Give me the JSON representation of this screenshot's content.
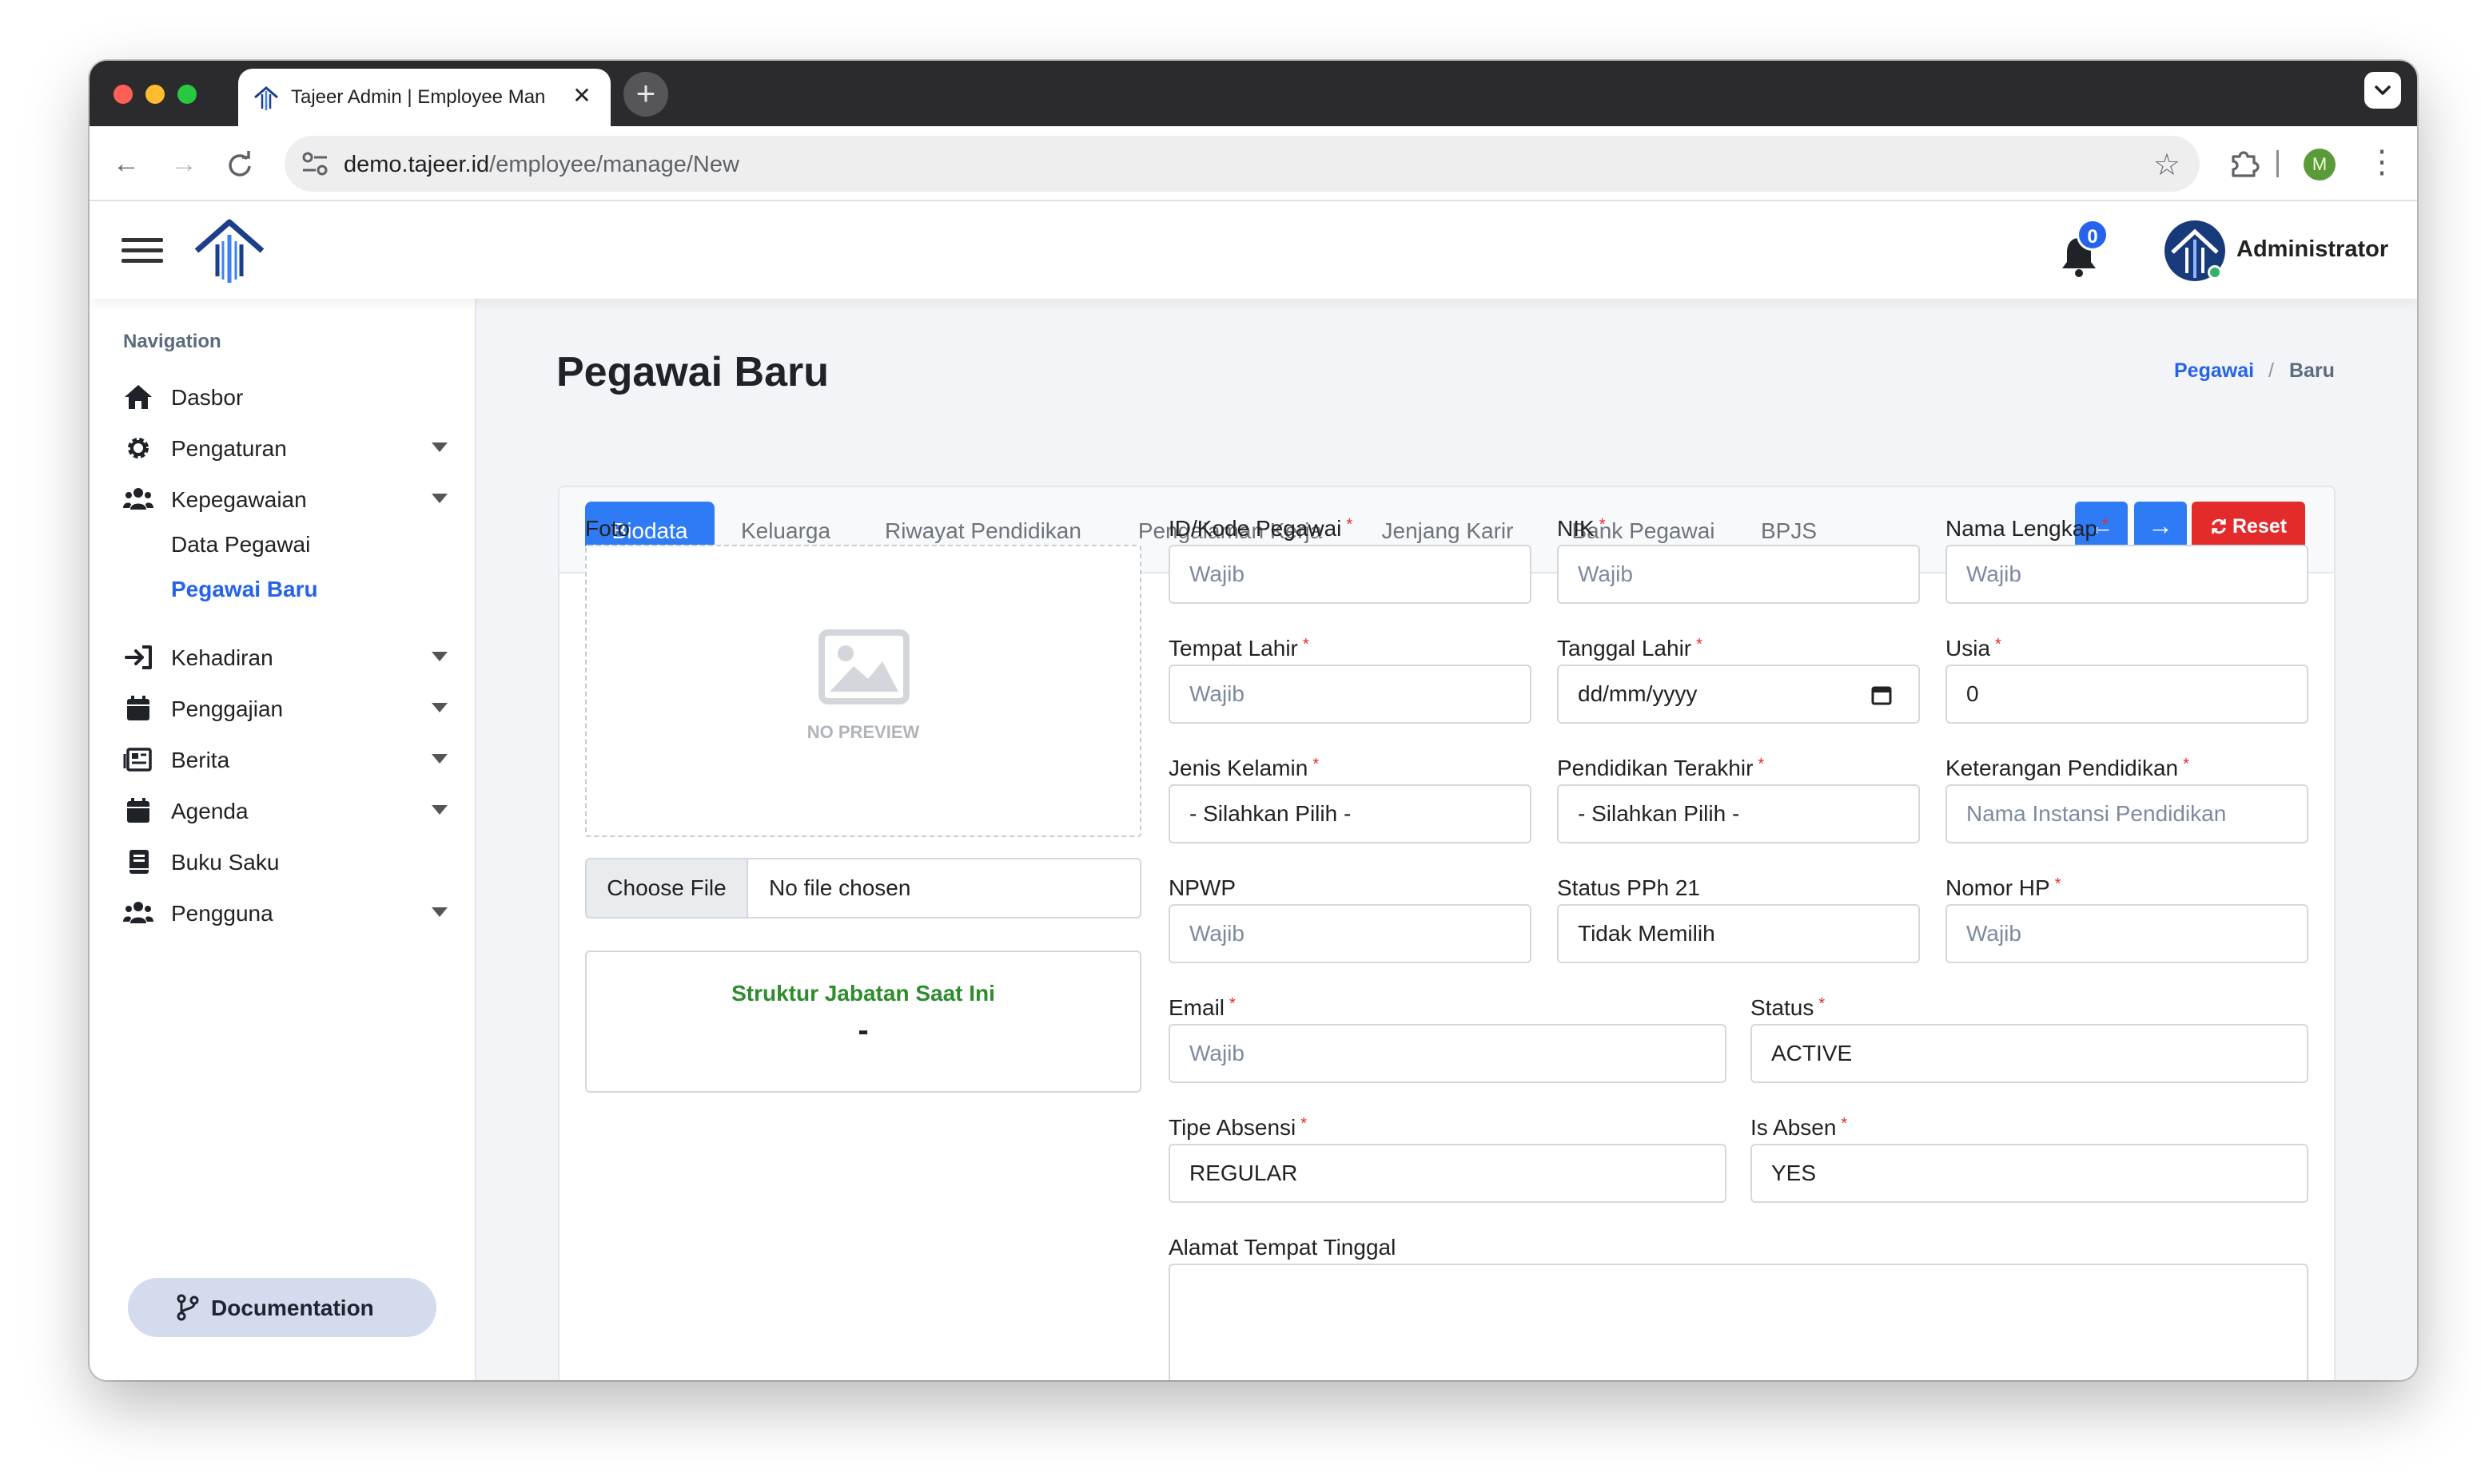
{
  "browser": {
    "tab_title": "Tajeer Admin | Employee Man",
    "url_host": "demo.tajeer.id",
    "url_path": "/employee/manage/New",
    "profile_initial": "M",
    "colors": {
      "close": "#ff5f57",
      "minimize": "#febc2e",
      "maximize": "#28c840"
    }
  },
  "header": {
    "notification_count": "0",
    "user_name": "Administrator"
  },
  "sidebar": {
    "heading": "Navigation",
    "items": [
      {
        "label": "Dasbor",
        "icon": "home-icon",
        "caret": false
      },
      {
        "label": "Pengaturan",
        "icon": "gear-icon",
        "caret": true
      },
      {
        "label": "Kepegawaian",
        "icon": "users-icon",
        "caret": true
      },
      {
        "label": "Kehadiran",
        "icon": "sign-in-icon",
        "caret": true
      },
      {
        "label": "Penggajian",
        "icon": "calendar-icon",
        "caret": true
      },
      {
        "label": "Berita",
        "icon": "newspaper-icon",
        "caret": true
      },
      {
        "label": "Agenda",
        "icon": "calendar-icon",
        "caret": true
      },
      {
        "label": "Buku Saku",
        "icon": "book-icon",
        "caret": false
      },
      {
        "label": "Pengguna",
        "icon": "users-icon",
        "caret": true
      }
    ],
    "subitems": [
      {
        "label": "Data Pegawai",
        "active": false
      },
      {
        "label": "Pegawai Baru",
        "active": true
      }
    ],
    "doc_label": "Documentation"
  },
  "page": {
    "title": "Pegawai Baru",
    "breadcrumb": {
      "first": "Pegawai",
      "sep": "/",
      "current": "Baru"
    }
  },
  "tabs": [
    "Biodata",
    "Keluarga",
    "Riwayat Pendidikan",
    "Pengalaman Kerja",
    "Jenjang Karir",
    "Bank Pegawai",
    "BPJS"
  ],
  "actions": {
    "prev": "←",
    "next": "→",
    "reset": "Reset"
  },
  "photo": {
    "label": "Foto",
    "no_preview": "NO PREVIEW",
    "choose_file": "Choose File",
    "no_file": "No file chosen",
    "struktur_title": "Struktur Jabatan Saat Ini",
    "struktur_value": "-"
  },
  "form": {
    "id_kode": {
      "label": "ID/Kode Pegawai",
      "placeholder": "Wajib"
    },
    "nik": {
      "label": "NIK",
      "placeholder": "Wajib"
    },
    "nama": {
      "label": "Nama Lengkap",
      "placeholder": "Wajib"
    },
    "tempat_lahir": {
      "label": "Tempat Lahir",
      "placeholder": "Wajib"
    },
    "tanggal_lahir": {
      "label": "Tanggal Lahir",
      "value": "dd/mm/yyyy"
    },
    "usia": {
      "label": "Usia",
      "value": "0"
    },
    "jenis_kelamin": {
      "label": "Jenis Kelamin",
      "value": "- Silahkan Pilih -"
    },
    "pendidikan": {
      "label": "Pendidikan Terakhir",
      "value": "- Silahkan Pilih -"
    },
    "ket_pendidikan": {
      "label": "Keterangan Pendidikan",
      "placeholder": "Nama Instansi Pendidikan"
    },
    "npwp": {
      "label": "NPWP",
      "placeholder": "Wajib"
    },
    "status_pph": {
      "label": "Status PPh 21",
      "value": "Tidak Memilih"
    },
    "nomor_hp": {
      "label": "Nomor HP",
      "placeholder": "Wajib"
    },
    "email": {
      "label": "Email",
      "placeholder": "Wajib"
    },
    "status": {
      "label": "Status",
      "value": "ACTIVE"
    },
    "tipe_absensi": {
      "label": "Tipe Absensi",
      "value": "REGULAR"
    },
    "is_absen": {
      "label": "Is Absen",
      "value": "YES"
    },
    "alamat": {
      "label": "Alamat Tempat Tinggal"
    },
    "required_mark": "*"
  }
}
